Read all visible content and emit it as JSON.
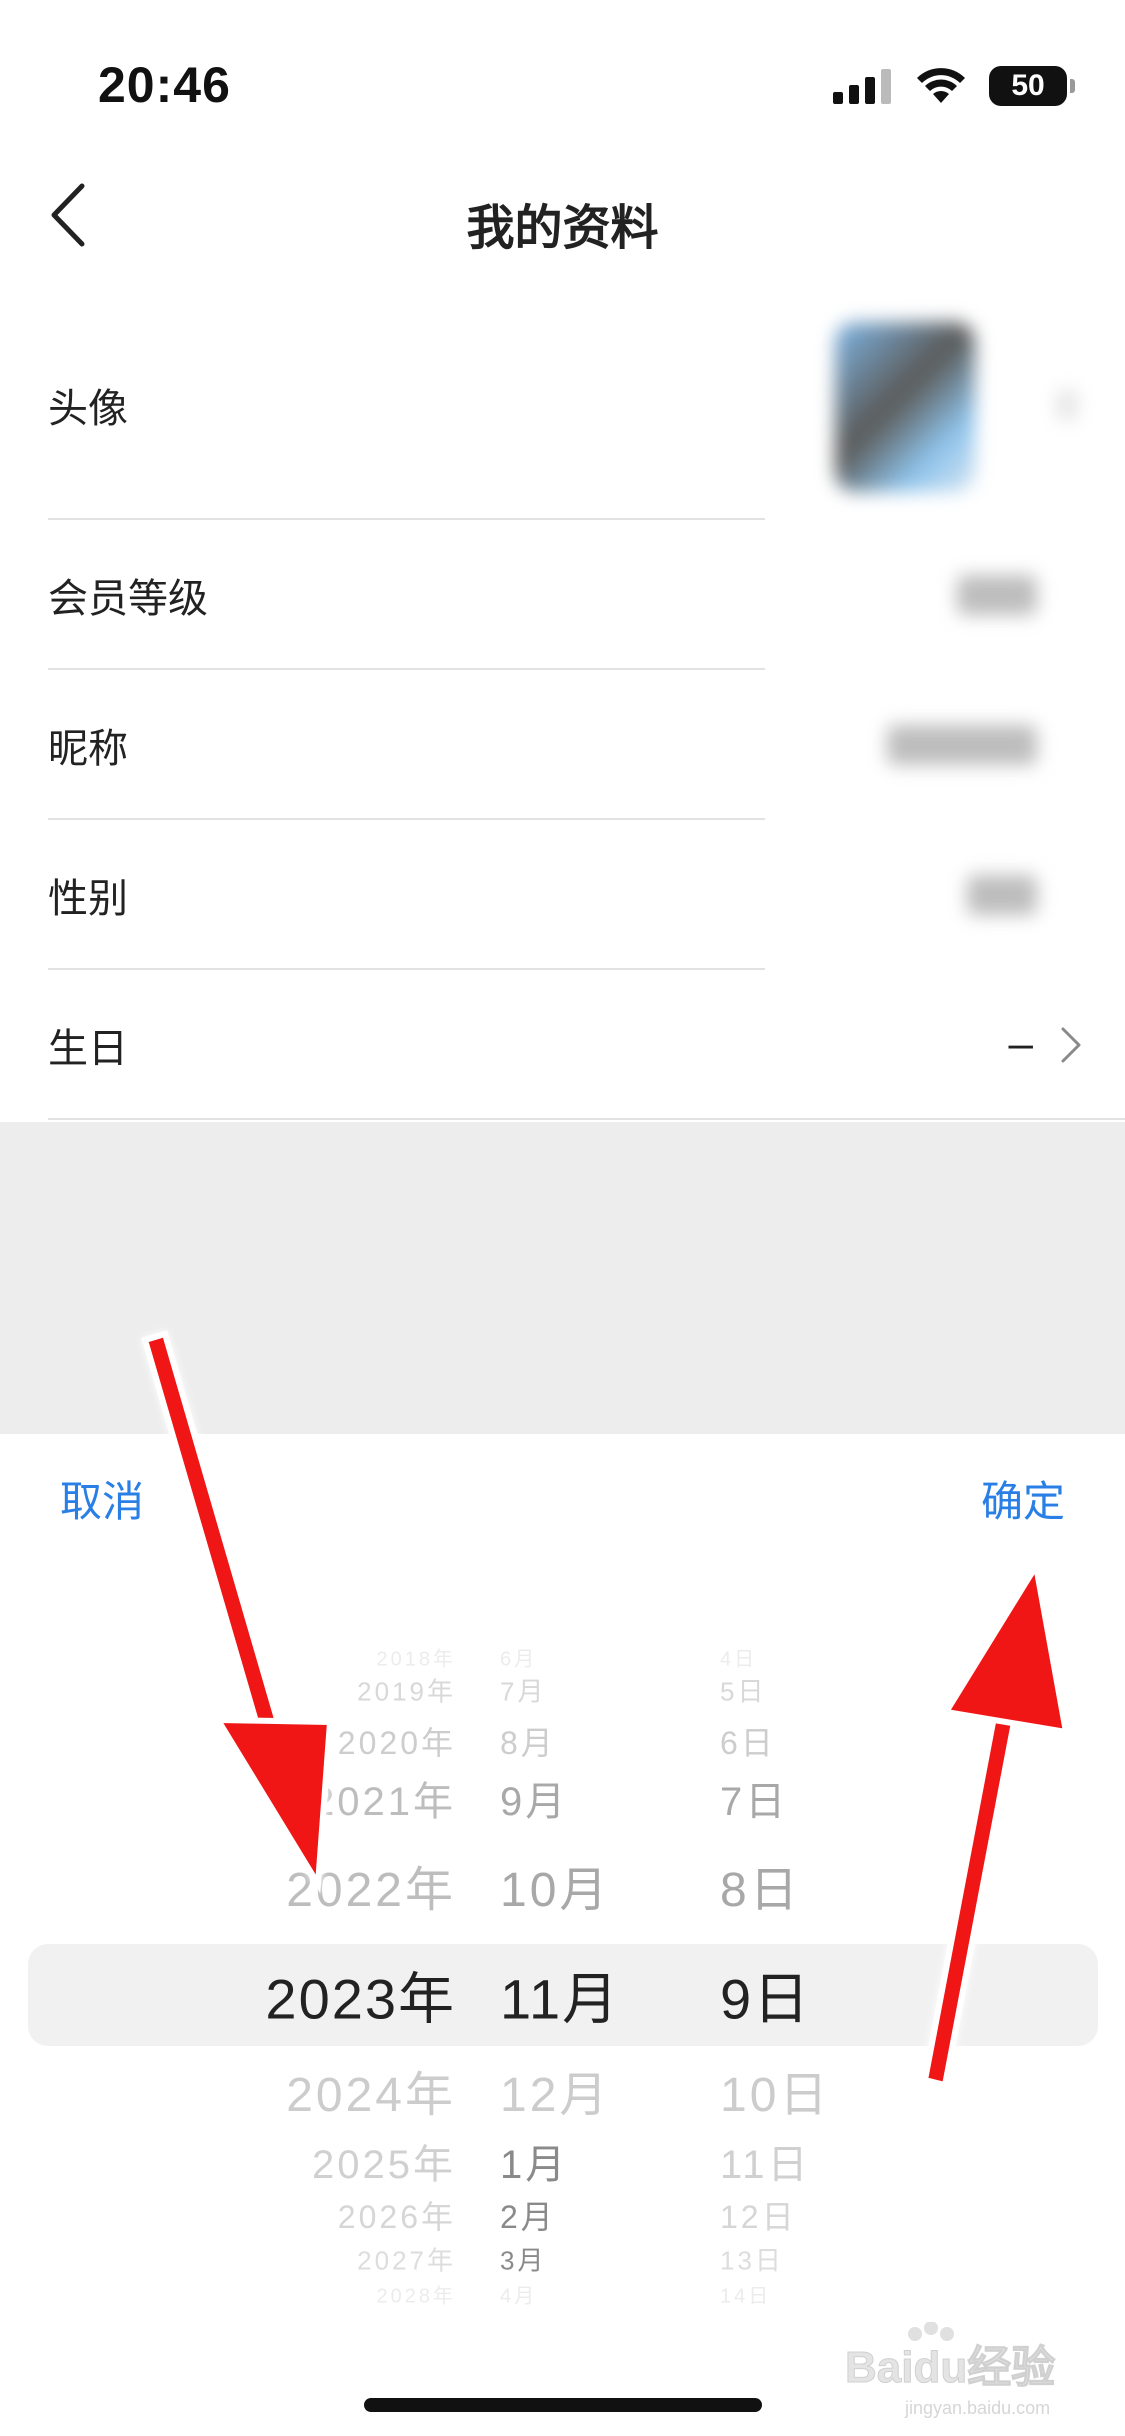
{
  "status_bar": {
    "time": "20:46",
    "battery": "50"
  },
  "nav": {
    "title": "我的资料"
  },
  "profile": {
    "rows": [
      {
        "label": "头像"
      },
      {
        "label": "会员等级"
      },
      {
        "label": "昵称"
      },
      {
        "label": "性别"
      },
      {
        "label": "生日",
        "value": "–"
      }
    ]
  },
  "picker": {
    "cancel": "取消",
    "confirm": "确定",
    "years": [
      "2018年",
      "2019年",
      "2020年",
      "2021年",
      "2022年",
      "2023年",
      "2024年",
      "2025年",
      "2026年",
      "2027年",
      "2028年"
    ],
    "months": [
      "6月",
      "7月",
      "8月",
      "9月",
      "10月",
      "11月",
      "12月",
      "1月",
      "2月",
      "3月",
      "4月"
    ],
    "days": [
      "4日",
      "5日",
      "6日",
      "7日",
      "8日",
      "9日",
      "10日",
      "11日",
      "12日",
      "13日",
      "14日"
    ],
    "selected": {
      "year": "2023年",
      "month": "11月",
      "day": "9日"
    }
  },
  "watermark": {
    "text": "Baidu经验",
    "subtext": "jingyan.baidu.com"
  },
  "colors": {
    "accent": "#2a7fe6",
    "arrow": "#f01818",
    "dim": "#ededed",
    "highlight": "#f1f1f1"
  }
}
